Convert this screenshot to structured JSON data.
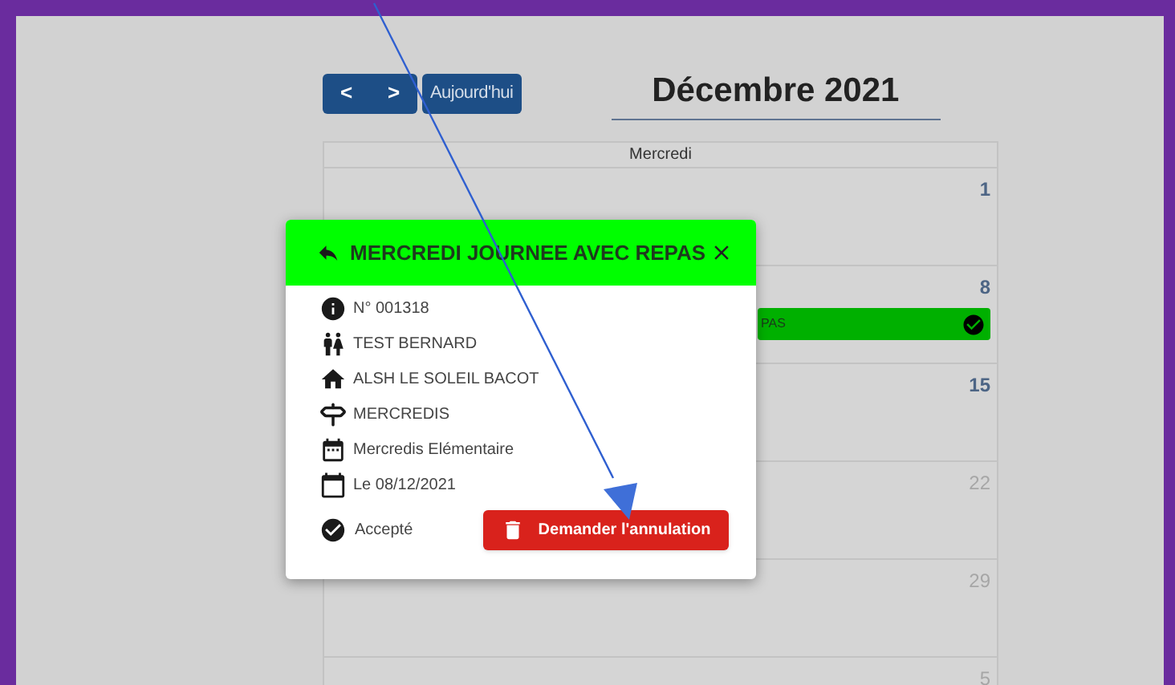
{
  "toolbar": {
    "prev": "<",
    "next": ">",
    "today": "Aujourd'hui",
    "title": "Décembre 2021"
  },
  "calendar": {
    "column": "Mercredi",
    "days": [
      {
        "number": "1",
        "highlighted": true
      },
      {
        "number": "8",
        "highlighted": true,
        "events": [
          {
            "label": "PAS",
            "accepted": true
          }
        ]
      },
      {
        "number": "15",
        "highlighted": true
      },
      {
        "number": "22",
        "highlighted": false
      },
      {
        "number": "29",
        "highlighted": false
      },
      {
        "number": "5",
        "highlighted": false
      }
    ]
  },
  "popup": {
    "title": "MERCREDI JOURNEE AVEC REPAS",
    "details": [
      {
        "kind": "info",
        "text": "N° 001318"
      },
      {
        "kind": "person",
        "text": "TEST BERNARD"
      },
      {
        "kind": "place",
        "text": "ALSH LE SOLEIL BACOT"
      },
      {
        "kind": "activity",
        "text": "MERCREDIS"
      },
      {
        "kind": "period",
        "text": "Mercredis Elémentaire"
      },
      {
        "kind": "date",
        "text": "Le 08/12/2021"
      }
    ],
    "status": "Accepté",
    "action": "Demander l'annulation"
  }
}
